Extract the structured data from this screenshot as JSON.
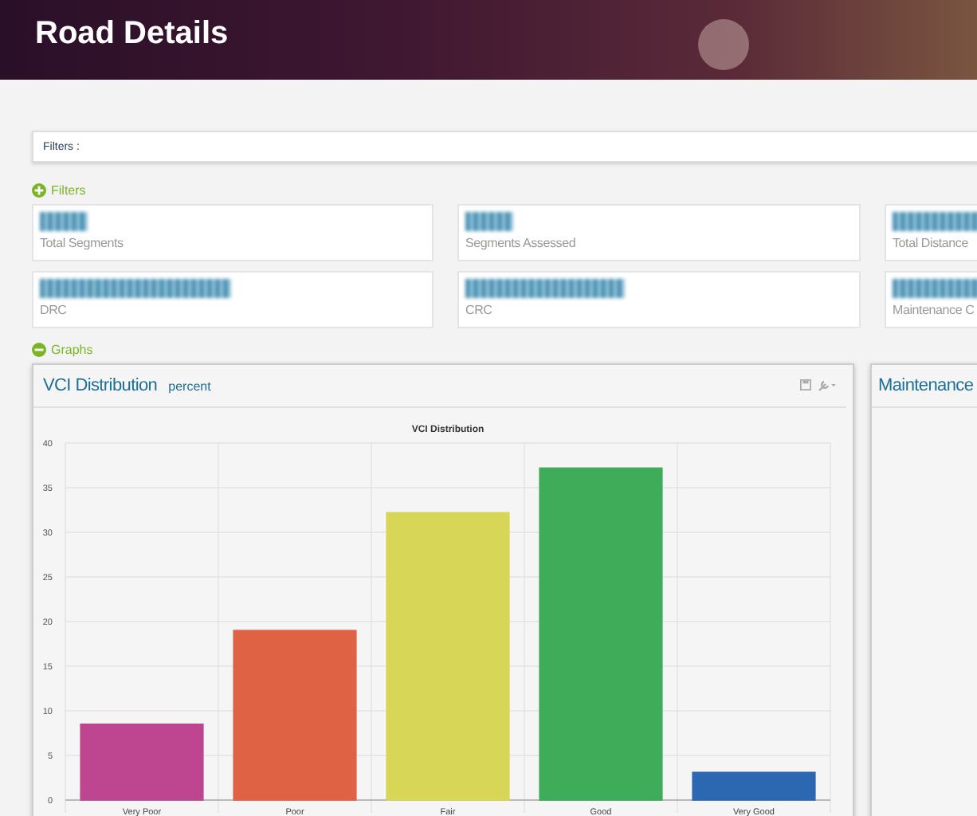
{
  "header": {
    "title": "Road Details"
  },
  "filters_bar": {
    "label": "Filters :"
  },
  "filters_toggle": {
    "label": "Filters",
    "expanded": false
  },
  "stats": [
    {
      "label": "Total Segments"
    },
    {
      "label": "Segments Assessed"
    },
    {
      "label": "Total Distance"
    },
    {
      "label": "DRC"
    },
    {
      "label": "CRC"
    },
    {
      "label": "Maintenance C"
    }
  ],
  "graphs_toggle": {
    "label": "Graphs",
    "expanded": true
  },
  "panels": [
    {
      "title": "VCI Distribution",
      "chart_data": {
        "type": "bar",
        "grid": true,
        "title": "VCI Distribution",
        "categories": [
          "Very Poor",
          "Poor",
          "Fair",
          "Good",
          "Very Good"
        ],
        "series": [
          {
            "name": "percent",
            "values": [
              8.5,
              19,
              32.2,
              37.2,
              3.1
            ]
          }
        ],
        "colors": [
          "#cc4a9a",
          "#f0694a",
          "#e8e65c",
          "#43b95f",
          "#2f6fbf"
        ],
        "ylim": [
          0,
          40
        ],
        "yticks": [
          0,
          5,
          10,
          15,
          20,
          25,
          30,
          35,
          40
        ]
      }
    },
    {
      "title": "Maintenance"
    }
  ]
}
